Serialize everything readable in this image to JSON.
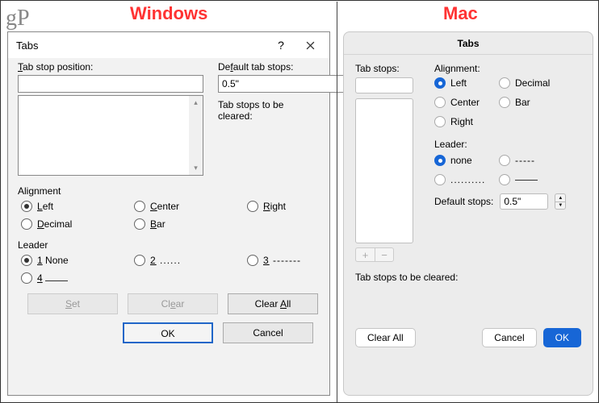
{
  "logo": "gP",
  "os_labels": {
    "windows": "Windows",
    "mac": "Mac"
  },
  "windows": {
    "title": "Tabs",
    "help_symbol": "?",
    "tab_stop_position_label": "Tab stop position:",
    "default_tab_stops_label": "Default tab stops:",
    "default_tab_stops_value": "0.5\"",
    "to_be_cleared_label": "Tab stops to be cleared:",
    "alignment_label": "Alignment",
    "alignment": {
      "left": "Left",
      "center": "Center",
      "right": "Right",
      "decimal": "Decimal",
      "bar": "Bar"
    },
    "leader_label": "Leader",
    "leader": {
      "none": "1 None",
      "dots": "2 ......",
      "dashes": "3 -------",
      "underline": "4 ___"
    },
    "buttons": {
      "set": "Set",
      "clear": "Clear",
      "clear_all": "Clear All",
      "ok": "OK",
      "cancel": "Cancel"
    }
  },
  "mac": {
    "title": "Tabs",
    "tab_stops_label": "Tab stops:",
    "alignment_label": "Alignment:",
    "alignment": {
      "left": "Left",
      "decimal": "Decimal",
      "center": "Center",
      "bar": "Bar",
      "right": "Right"
    },
    "leader_label": "Leader:",
    "leader": {
      "none": "none",
      "dashes": "-----",
      "dots": "..........",
      "underline": "______"
    },
    "default_stops_label": "Default stops:",
    "default_stops_value": "0.5\"",
    "to_be_cleared_label": "Tab stops to be cleared:",
    "buttons": {
      "clear_all": "Clear All",
      "cancel": "Cancel",
      "ok": "OK"
    },
    "plus": "+",
    "minus": "−"
  }
}
